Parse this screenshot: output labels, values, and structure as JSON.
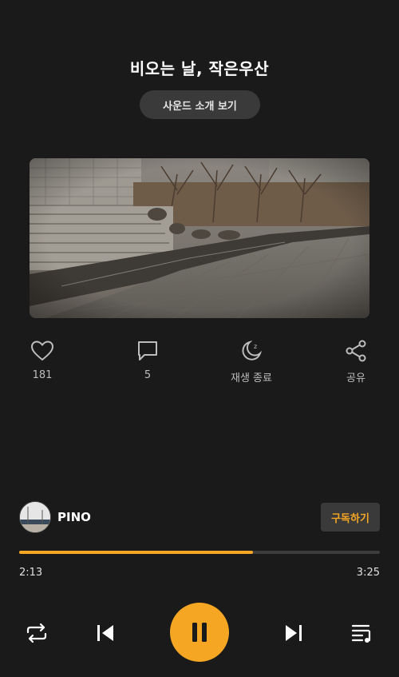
{
  "track": {
    "title": "비오는 날, 작은우산",
    "intro_button": "사운드 소개 보기"
  },
  "actions": {
    "like": {
      "icon": "heart-icon",
      "label": "181"
    },
    "comment": {
      "icon": "comment-icon",
      "label": "5"
    },
    "sleep_timer": {
      "icon": "moon-icon",
      "label": "재생 종료"
    },
    "share": {
      "icon": "share-icon",
      "label": "공유"
    }
  },
  "artist": {
    "name": "PINO",
    "subscribe_label": "구독하기"
  },
  "player": {
    "current_time": "2:13",
    "total_time": "3:25",
    "progress": 0.649
  },
  "controls": [
    "repeat-icon",
    "previous-icon",
    "pause-icon",
    "next-icon",
    "playlist-icon"
  ],
  "colors": {
    "accent": "#f5a623",
    "background": "#1a1a1a",
    "button_bg": "#3a3a3a"
  }
}
